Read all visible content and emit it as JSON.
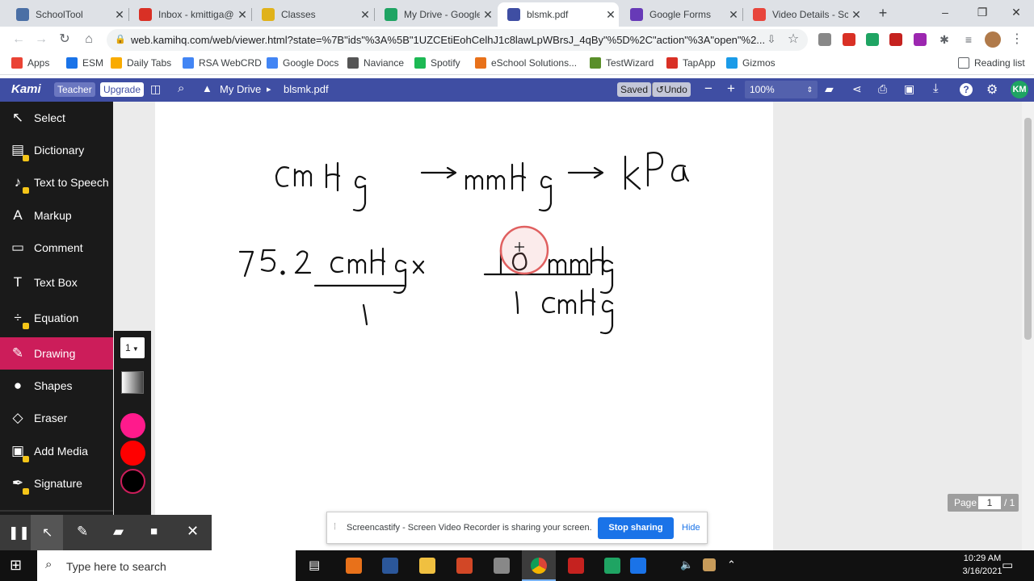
{
  "tabs": [
    {
      "title": "SchoolTool",
      "color": "#4a6fa5",
      "icon": "schooltool-icon"
    },
    {
      "title": "Inbox - kmittiga@",
      "color": "#d93025",
      "icon": "gmail-icon"
    },
    {
      "title": "Classes",
      "color": "#e0b21a",
      "icon": "classroom-icon"
    },
    {
      "title": "My Drive - Google",
      "color": "#1fa463",
      "icon": "drive-icon"
    },
    {
      "title": "blsmk.pdf",
      "color": "#3f4ea3",
      "icon": "kami-icon",
      "active": true
    },
    {
      "title": "Google Forms",
      "color": "#673ab7",
      "icon": "forms-icon"
    },
    {
      "title": "Video Details - Scr",
      "color": "#e8453c",
      "icon": "screencastify-icon"
    }
  ],
  "new_tab": "+",
  "address": {
    "url": "web.kamihq.com/web/viewer.html?state=%7B\"ids\"%3A%5B\"1UZCEtiEohCelhJ1c8lawLpWBrsJ_4qBy\"%5D%2C\"action\"%3A\"open\"%2..."
  },
  "bookmarks": [
    {
      "label": "Apps",
      "color": "#ea4335"
    },
    {
      "label": "ESM",
      "color": "#1a73e8"
    },
    {
      "label": "Daily Tabs",
      "color": "#f9ab00"
    },
    {
      "label": "RSA WebCRD",
      "color": "#4285f4"
    },
    {
      "label": "Google Docs",
      "color": "#4285f4"
    },
    {
      "label": "Naviance",
      "color": "#555555"
    },
    {
      "label": "Spotify",
      "color": "#1db954"
    },
    {
      "label": "eSchool Solutions...",
      "color": "#e8711a"
    },
    {
      "label": "TestWizard",
      "color": "#5a8f29"
    },
    {
      "label": "TapApp",
      "color": "#d93025"
    },
    {
      "label": "Gizmos",
      "color": "#1a9be8"
    }
  ],
  "reading_list": "Reading list",
  "kami": {
    "logo": "Kami",
    "teacher": "Teacher",
    "upgrade": "Upgrade",
    "breadcrumb_drive": "My Drive",
    "breadcrumb_sep": "▸",
    "filename": "blsmk.pdf",
    "saved": "Saved",
    "undo": "Undo",
    "zoom": "100%",
    "avatar": "KM"
  },
  "sidebar": [
    {
      "label": "Select",
      "icon": "cursor-icon",
      "glyph": "↖",
      "locked": false
    },
    {
      "label": "Dictionary",
      "icon": "book-icon",
      "glyph": "▤",
      "locked": true
    },
    {
      "label": "Text to Speech",
      "icon": "speaker-icon",
      "glyph": "♪",
      "locked": true
    },
    {
      "label": "Markup",
      "icon": "markup-icon",
      "glyph": "A",
      "locked": false
    },
    {
      "label": "Comment",
      "icon": "comment-icon",
      "glyph": "▭",
      "locked": false
    },
    {
      "label": "Text Box",
      "icon": "textbox-icon",
      "glyph": "T",
      "locked": false
    },
    {
      "label": "Equation",
      "icon": "equation-icon",
      "glyph": "÷",
      "locked": true
    },
    {
      "label": "Drawing",
      "icon": "brush-icon",
      "glyph": "✎",
      "locked": false,
      "active": true
    },
    {
      "label": "Shapes",
      "icon": "shapes-icon",
      "glyph": "●",
      "locked": false
    },
    {
      "label": "Eraser",
      "icon": "eraser-icon",
      "glyph": "◇",
      "locked": false
    },
    {
      "label": "Add Media",
      "icon": "media-icon",
      "glyph": "▣",
      "locked": true
    },
    {
      "label": "Signature",
      "icon": "signature-icon",
      "glyph": "✒",
      "locked": true
    }
  ],
  "drawing_panel": {
    "size": "1",
    "colors": [
      "#ff1a8c",
      "#ff0000",
      "#000000"
    ]
  },
  "page_indicator": {
    "label": "Page",
    "current": "1",
    "total": "/ 1"
  },
  "share_banner": {
    "text": "Screencastify - Screen Video Recorder is sharing your screen.",
    "stop": "Stop sharing",
    "hide": "Hide"
  },
  "taskbar": {
    "search": "Type here to search",
    "time": "10:29 AM",
    "date": "3/16/2021"
  }
}
